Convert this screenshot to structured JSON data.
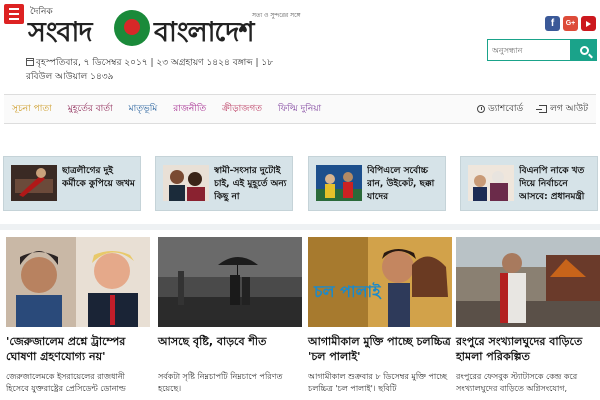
{
  "header": {
    "logo_small": "দৈনিক",
    "logo_left": "সংবাদ",
    "logo_right": "বাংলাদেশ",
    "tagline": "সত্য ও সুন্দরের সঙ্গে",
    "date": "বৃহস্পতিবার, ৭ ডিসেম্বর ২০১৭ | ২৩ অগ্রহায়ণ ১৪২৪ বঙ্গাব্দ | ১৮ রবিউল আউয়াল ১৪৩৯",
    "search_placeholder": "অনুসন্ধান",
    "social": [
      "f",
      "G+",
      "youtube"
    ],
    "accent": "#1aa38a"
  },
  "nav": {
    "items": [
      "সূচনা পাতা",
      "মুহূর্তের বার্তা",
      "মাতৃভূমি",
      "রাজনীতি",
      "ক্রীড়াজগত",
      "ফিল্মি দুনিয়া"
    ],
    "dashboard": "ড্যাশবোর্ড",
    "logout": "লগ আউট"
  },
  "ticker": [
    {
      "text": "ছাত্রলীগের দুই কর্মীকে কুপিয়ে জখম"
    },
    {
      "text": "স্বামী-সংসার দুটোই চাই, এই মুহূর্তে অন্য কিছু না"
    },
    {
      "text": "বিপিএলে সর্বোচ্চ রান, উইকেট, ছক্কা যাদের"
    },
    {
      "text": "বিএনপি নাকে খত দিয়ে নির্বাচনে আসবে: প্রধানমন্ত্রী"
    }
  ],
  "cards": [
    {
      "title": "'জেরুজালেম প্রশ্নে ট্রাম্পের ঘোষণা গ্রহণযোগ্য নয়'",
      "desc": "জেরুজালেমকে ইসরায়েলের রাজধানী হিসেবে যুক্তরাষ্ট্রের প্রেসিডেন্ট ডোনাল্ড"
    },
    {
      "title": "আসছে বৃষ্টি, বাড়বে শীত",
      "desc": "সর্বকটা সৃষ্টি নিম্নচাপটি নিম্নচাপে পরিণত হয়েছে।"
    },
    {
      "title": "আগামীকাল মুক্তি পাচ্ছে চলচ্চিত্র 'চল পালাই'",
      "desc": "আগামীকাল শুক্রবার ৮ ডিসেম্বর মুক্তি পাচ্ছে চলচ্চিত্র 'চল পালাই'। ছবিটি"
    },
    {
      "title": "রংপুরে সংখ্যালঘুদের বাড়িতে হামলা পরিকল্পিত",
      "desc": "রংপুরের ফেসবুক স্ট্যাটাসকে কেন্দ্র করে সংখ্যালঘুদের বাড়িতে অগ্নিসংযোগ,"
    }
  ]
}
